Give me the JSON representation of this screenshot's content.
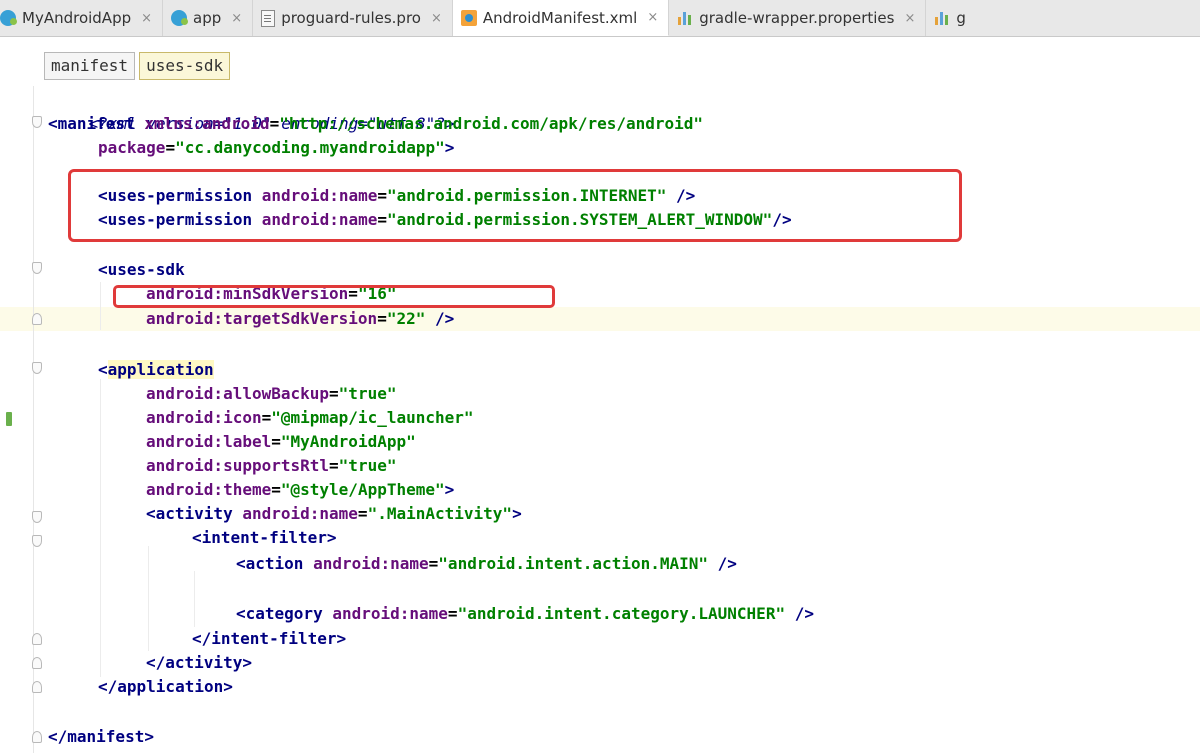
{
  "tabs": [
    {
      "label": "MyAndroidApp",
      "icon": "module-icon",
      "close": "×"
    },
    {
      "label": "app",
      "icon": "module-icon",
      "close": "×"
    },
    {
      "label": "proguard-rules.pro",
      "icon": "file-icon",
      "close": "×"
    },
    {
      "label": "AndroidManifest.xml",
      "icon": "xml-icon",
      "close": "×",
      "active": true
    },
    {
      "label": "gradle-wrapper.properties",
      "icon": "properties-icon",
      "close": "×"
    },
    {
      "label": "g",
      "icon": "properties-icon"
    }
  ],
  "breadcrumb": [
    "manifest",
    "uses-sdk"
  ],
  "code": {
    "l1_pi": "<?xml version=\"1.0\" encoding=\"utf-8\"?>",
    "l2_open": "<manifest ",
    "l2_attr": "xmlns:android",
    "l2_eq": "=",
    "l2_val": "\"http://schemas.android.com/apk/res/android\"",
    "l3_attr": "package",
    "l3_eq": "=",
    "l3_val": "\"cc.danycoding.myandroidapp\"",
    "l3_end": ">",
    "l5_tag": "<uses-permission ",
    "l5_attr": "android:name",
    "l5_eq": "=",
    "l5_val": "\"android.permission.INTERNET\"",
    "l5_end": " />",
    "l6_tag": "<uses-permission ",
    "l6_attr": "android:name",
    "l6_eq": "=",
    "l6_val": "\"android.permission.SYSTEM_ALERT_WINDOW\"",
    "l6_end": "/>",
    "l8_tag": "<uses-sdk",
    "l9_attr": "android:minSdkVersion",
    "l9_eq": "=",
    "l9_val": "\"16\"",
    "l10_attr": "android:targetSdkVersion",
    "l10_eq": "=",
    "l10_val": "\"22\"",
    "l10_end": " />",
    "l12_lt": "<",
    "l12_tag": "application",
    "l13_attr": "android:allowBackup",
    "l13_eq": "=",
    "l13_val": "\"true\"",
    "l14_attr": "android:icon",
    "l14_eq": "=",
    "l14_val": "\"@mipmap/ic_launcher\"",
    "l15_attr": "android:label",
    "l15_eq": "=",
    "l15_val": "\"MyAndroidApp\"",
    "l16_attr": "android:supportsRtl",
    "l16_eq": "=",
    "l16_val": "\"true\"",
    "l17_attr": "android:theme",
    "l17_eq": "=",
    "l17_val": "\"@style/AppTheme\"",
    "l17_end": ">",
    "l18_tag": "<activity ",
    "l18_attr": "android:name",
    "l18_eq": "=",
    "l18_val": "\".MainActivity\"",
    "l18_end": ">",
    "l19_tag": "<intent-filter>",
    "l20_tag": "<action ",
    "l20_attr": "android:name",
    "l20_eq": "=",
    "l20_val": "\"android.intent.action.MAIN\"",
    "l20_end": " />",
    "l22_tag": "<category ",
    "l22_attr": "android:name",
    "l22_eq": "=",
    "l22_val": "\"android.intent.category.LAUNCHER\"",
    "l22_end": " />",
    "l23_tag": "</intent-filter>",
    "l24_tag": "</activity>",
    "l25_tag": "</application>",
    "l27_tag": "</manifest>"
  },
  "colors": {
    "annotation_red": "#e03a3a",
    "xml_tag": "#000080",
    "xml_attr": "#660e7a",
    "xml_value": "#008000"
  }
}
